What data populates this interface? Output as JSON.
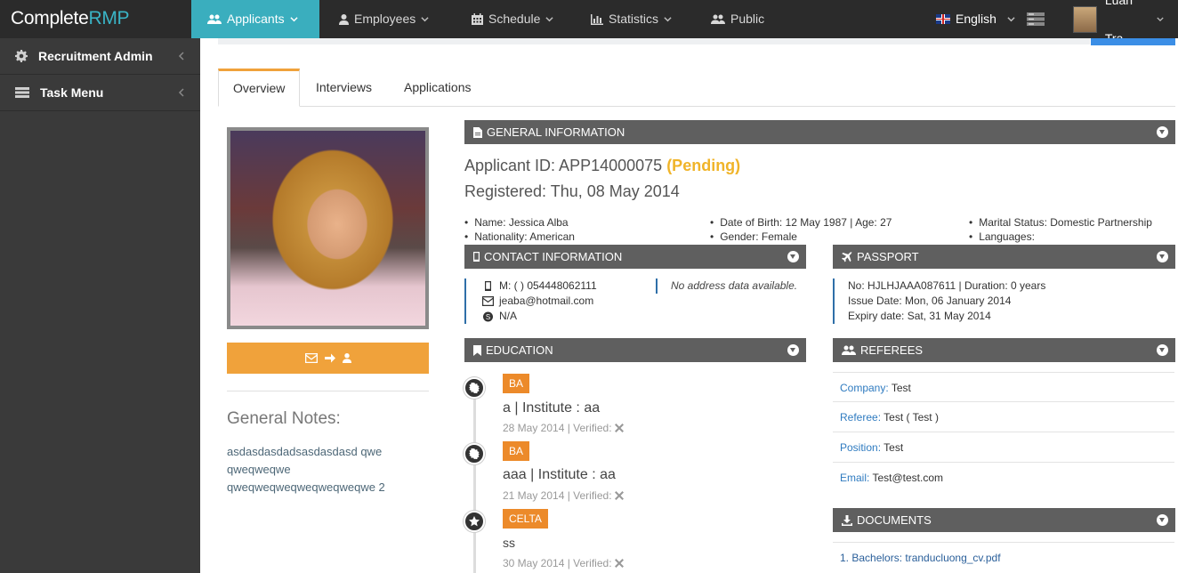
{
  "brand": {
    "prefix": "Complete",
    "suffix": "RMP"
  },
  "nav": {
    "items": [
      {
        "label": "Applicants"
      },
      {
        "label": "Employees"
      },
      {
        "label": "Schedule"
      },
      {
        "label": "Statistics"
      },
      {
        "label": "Public"
      }
    ],
    "language": "English",
    "user": "Luan Tra"
  },
  "sidebar": {
    "items": [
      {
        "label": "Recruitment Admin"
      },
      {
        "label": "Task Menu"
      }
    ]
  },
  "tabs": [
    "Overview",
    "Interviews",
    "Applications"
  ],
  "general": {
    "header": "GENERAL INFORMATION",
    "applicant_id_label": "Applicant ID: APP14000075",
    "status": "(Pending)",
    "registered": "Registered: Thu, 08 May 2014",
    "name": "Name: Jessica Alba",
    "nationality": "Nationality: American",
    "dob": "Date of Birth: 12 May 1987 | Age: 27",
    "gender": "Gender: Female",
    "marital": "Marital Status: Domestic Partnership",
    "languages": "Languages:"
  },
  "contact": {
    "header": "CONTACT INFORMATION",
    "mobile": "M: ( ) 054448062111",
    "email": "jeaba@hotmail.com",
    "skype": "N/A",
    "no_address": "No address data available."
  },
  "passport": {
    "header": "PASSPORT",
    "number": "No: HJLHJAAA087611 | Duration: 0 years",
    "issue": "Issue Date: Mon, 06 January 2014",
    "expiry": "Expiry date: Sat, 31 May 2014"
  },
  "education": {
    "header": "EDUCATION",
    "items": [
      {
        "badge": "BA",
        "title": "a | Institute : aa",
        "meta": "28 May 2014 | Verified:"
      },
      {
        "badge": "BA",
        "title": "aaa | Institute : aa",
        "meta": "21 May 2014 | Verified:"
      },
      {
        "badge": "CELTA",
        "title": "ss",
        "meta": "30 May 2014 | Verified:"
      }
    ]
  },
  "referees": {
    "header": "REFEREES",
    "rows": [
      {
        "key": "Company:",
        "value": "Test"
      },
      {
        "key": "Referee:",
        "value": "Test ( Test )"
      },
      {
        "key": "Position:",
        "value": "Test"
      },
      {
        "key": "Email:",
        "value": "Test@test.com"
      }
    ]
  },
  "documents": {
    "header": "DOCUMENTS",
    "first": "1. Bachelors: tranducluong_cv.pdf"
  },
  "notes": {
    "title": "General Notes:",
    "text": "asdasdasdadsasdasdasd qwe qweqweqwe qweqweqweqweqweqweqwe 2"
  },
  "colors": {
    "accent": "#3aaebe",
    "orange": "#f0a23b",
    "pending": "#f0b429",
    "panel": "#5f5f5f"
  }
}
